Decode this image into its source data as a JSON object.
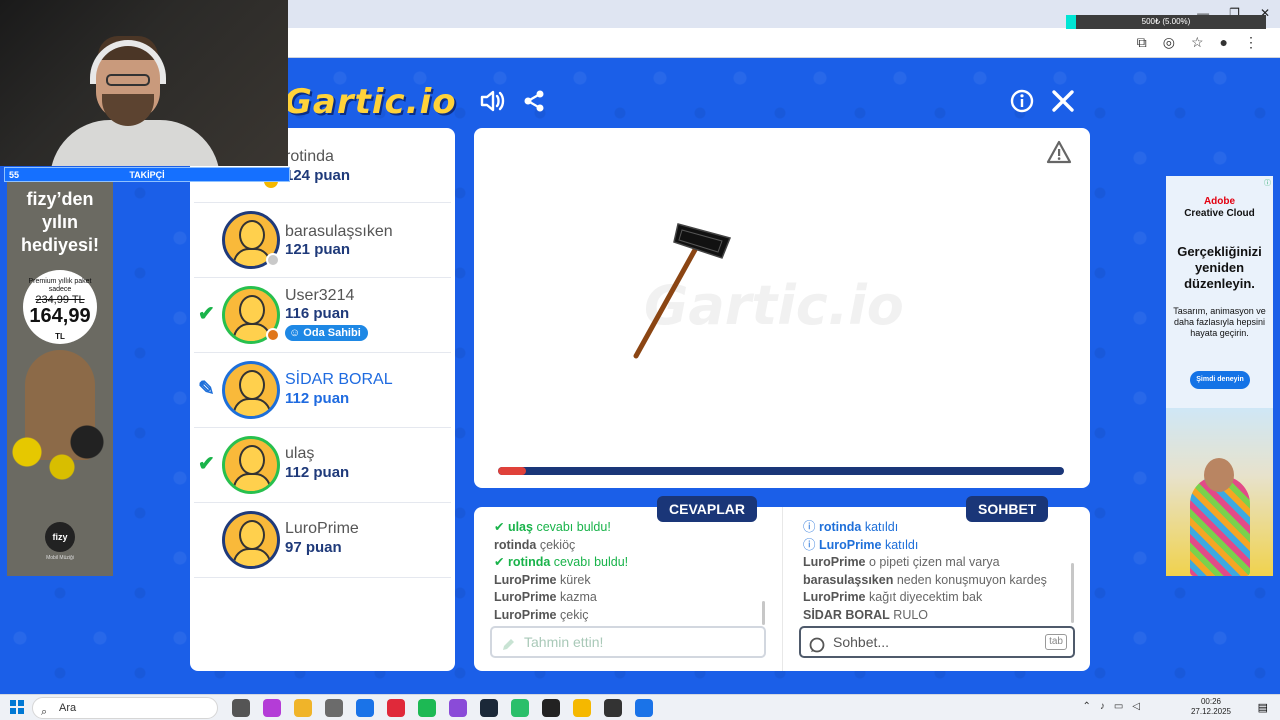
{
  "stream": {
    "progress_text": "500₺ (5.00%)",
    "progress_fraction": 0.05,
    "follower_count": "55",
    "follower_label": "TAKİPÇİ"
  },
  "header": {
    "logo": "Gartic.io"
  },
  "players": [
    {
      "name": "rotinda",
      "points": "124 puan",
      "status": "guessed",
      "dot_label": "100"
    },
    {
      "name": "barasulaşsıken",
      "points": "121 puan",
      "status": "none"
    },
    {
      "name": "User3214",
      "points": "116 puan",
      "status": "guessed",
      "owner_label": "Oda Sahibi"
    },
    {
      "name": "SİDAR BORAL",
      "points": "112 puan",
      "status": "drawing"
    },
    {
      "name": "ulaş",
      "points": "112 puan",
      "status": "guessed"
    },
    {
      "name": "LuroPrime",
      "points": "97 puan",
      "status": "none"
    }
  ],
  "canvas": {
    "watermark": "Gartic.io",
    "time_fraction": 0.05
  },
  "answers": {
    "label": "CEVAPLAR",
    "messages": [
      {
        "who": "ulaş",
        "text": "cevabı buldu!",
        "kind": "sys"
      },
      {
        "who": "rotinda",
        "text": "çekiöç",
        "kind": "normal"
      },
      {
        "who": "rotinda",
        "text": "cevabı buldu!",
        "kind": "sys"
      },
      {
        "who": "LuroPrime",
        "text": "kürek",
        "kind": "normal"
      },
      {
        "who": "LuroPrime",
        "text": "kazma",
        "kind": "normal"
      },
      {
        "who": "LuroPrime",
        "text": "çekiç",
        "kind": "normal"
      }
    ],
    "placeholder": "Tahmin ettin!"
  },
  "chat": {
    "label": "SOHBET",
    "messages": [
      {
        "who": "rotinda",
        "text": "katıldı",
        "kind": "join"
      },
      {
        "who": "LuroPrime",
        "text": "katıldı",
        "kind": "join"
      },
      {
        "who": "LuroPrime",
        "text": "o pipeti çizen mal varya",
        "kind": "normal"
      },
      {
        "who": "barasulaşsıken",
        "text": "neden konuşmuyon kardeş",
        "kind": "normal"
      },
      {
        "who": "LuroPrime",
        "text": "kağıt diyecektim bak",
        "kind": "normal"
      },
      {
        "who": "SİDAR BORAL",
        "text": "RULO",
        "kind": "normal"
      }
    ],
    "placeholder": "Sohbet...",
    "tab_hint": "tab"
  },
  "ad_left": {
    "title": "fizy’den yılın hediyesi!",
    "badge_text": "Premium yıllık paket sadece",
    "old_price": "234,99 TL",
    "new_price": "164,99",
    "currency": "TL",
    "brand": "fizy",
    "brand_sub": "Mobil Müziği"
  },
  "ad_right": {
    "brand_top": "Adobe",
    "brand_bottom": "Creative Cloud",
    "headline": "Gerçekliğinizi yeniden düzenleyin.",
    "description": "Tasarım, animasyon ve daha fazlasıyla hepsini hayata geçirin.",
    "cta": "Şimdi deneyin"
  },
  "taskbar": {
    "search_label": "Ara",
    "time": "00:26",
    "date": "27.12.2025",
    "app_colors": [
      "#555555",
      "#b43cd7",
      "#f0b429",
      "#6b6b6b",
      "#1a73e8",
      "#e0293a",
      "#1db954",
      "#8a4bd8",
      "#1b2838",
      "#2bbf6a",
      "#222222",
      "#f5b800",
      "#333333",
      "#1a73e8"
    ]
  }
}
